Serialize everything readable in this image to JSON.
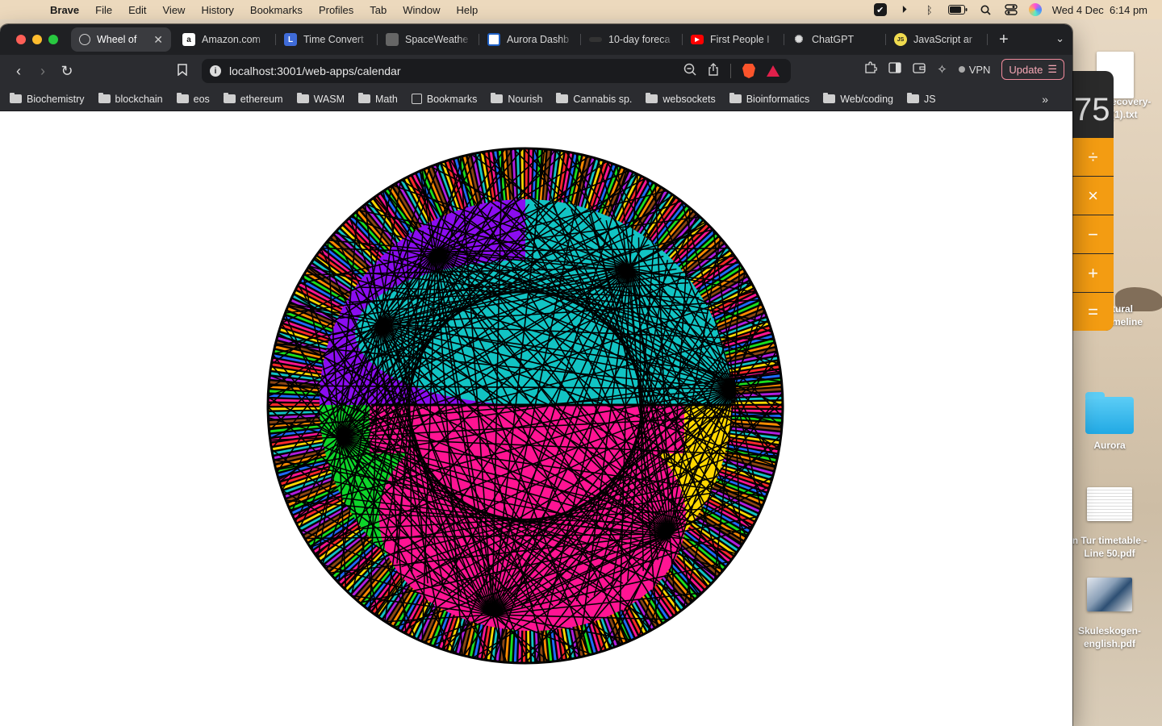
{
  "menubar": {
    "app_name": "Brave",
    "items": [
      "File",
      "Edit",
      "View",
      "History",
      "Bookmarks",
      "Profiles",
      "Tab",
      "Window",
      "Help"
    ],
    "datetime": "Wed 4 Dec  6:14 pm"
  },
  "tabs": [
    {
      "label": "Wheel of",
      "active": true,
      "favicon_color": "#9aa0a6"
    },
    {
      "label": "Amazon.com",
      "favicon_color": "#ffffff",
      "favicon_text": "a"
    },
    {
      "label": "Time Convert",
      "favicon_color": "#3f6bd8",
      "favicon_text": "L"
    },
    {
      "label": "SpaceWeathe",
      "favicon_color": "#555555"
    },
    {
      "label": "Aurora Dashb",
      "favicon_color": "#1e5fc4"
    },
    {
      "label": "10-day foreca",
      "favicon_color": "#333333"
    },
    {
      "label": "First People I",
      "favicon_color": "#ff0000",
      "favicon_text": "▶"
    },
    {
      "label": "ChatGPT",
      "favicon_color": "#1f2023",
      "favicon_text": "✺"
    },
    {
      "label": "JavaScript ar",
      "favicon_color": "#f0db4f",
      "favicon_text": "JS"
    }
  ],
  "toolbar": {
    "url": "localhost:3001/web-apps/calendar",
    "vpn_label": "VPN",
    "update_label": "Update"
  },
  "bookmarks": [
    {
      "label": "Biochemistry",
      "type": "folder"
    },
    {
      "label": "blockchain",
      "type": "folder"
    },
    {
      "label": "eos",
      "type": "folder"
    },
    {
      "label": "ethereum",
      "type": "folder"
    },
    {
      "label": "WASM",
      "type": "folder"
    },
    {
      "label": "Math",
      "type": "folder"
    },
    {
      "label": "Bookmarks",
      "type": "book"
    },
    {
      "label": "Nourish",
      "type": "folder"
    },
    {
      "label": "Cannabis sp.",
      "type": "folder"
    },
    {
      "label": "websockets",
      "type": "folder"
    },
    {
      "label": "Bioinformatics",
      "type": "folder"
    },
    {
      "label": "Web/coding",
      "type": "folder"
    },
    {
      "label": "JS",
      "type": "folder"
    }
  ],
  "wheel": {
    "quadrant_colors": {
      "top_left": "#8b0df0",
      "top_right": "#12c4c4",
      "bottom_left": "#0ed62a",
      "bottom_center": "#ff1493",
      "bottom_right": "#ffd700"
    },
    "ring_colors": [
      "#ff2a2a",
      "#ff8c00",
      "#ffd700",
      "#19e01f",
      "#12c4c4",
      "#1e6bff",
      "#b01ee0",
      "#ff1493",
      "#8b4513"
    ],
    "line_color": "#000000"
  },
  "calculator": {
    "display": "75",
    "ops": [
      "÷",
      "×",
      "−",
      "+",
      "="
    ]
  },
  "desktop": {
    "items": [
      {
        "name": "ecovery-\n(1).txt",
        "kind": "txt"
      },
      {
        "name": "tural\nmeline",
        "kind": "label"
      },
      {
        "name": "Aurora",
        "kind": "folder"
      },
      {
        "name": "n Tur timetable -\nLine 50.pdf",
        "kind": "pdf-table"
      },
      {
        "name": "Skuleskogen-\nenglish.pdf",
        "kind": "pdf-img"
      }
    ]
  }
}
